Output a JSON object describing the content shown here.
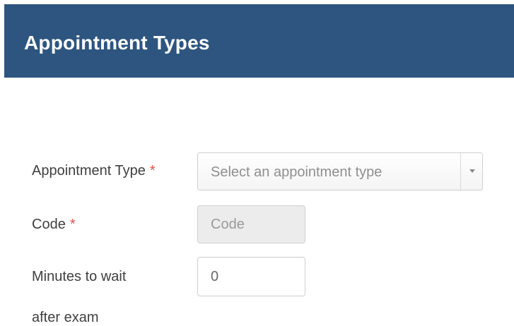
{
  "header": {
    "title": "Appointment Types"
  },
  "form": {
    "appointment_type": {
      "label": "Appointment Type",
      "required_mark": "*",
      "placeholder": "Select an appointment type"
    },
    "code": {
      "label": "Code",
      "required_mark": "*",
      "placeholder": "Code",
      "value": ""
    },
    "minutes_to_wait": {
      "label_line1": "Minutes to wait",
      "label_line2": "after exam",
      "value": "0"
    }
  },
  "colors": {
    "header_bg": "#2d5580",
    "required": "#d9534f",
    "disabled_input_bg": "#ececec"
  },
  "icons": {
    "select_arrow": "chevron-down-icon"
  }
}
